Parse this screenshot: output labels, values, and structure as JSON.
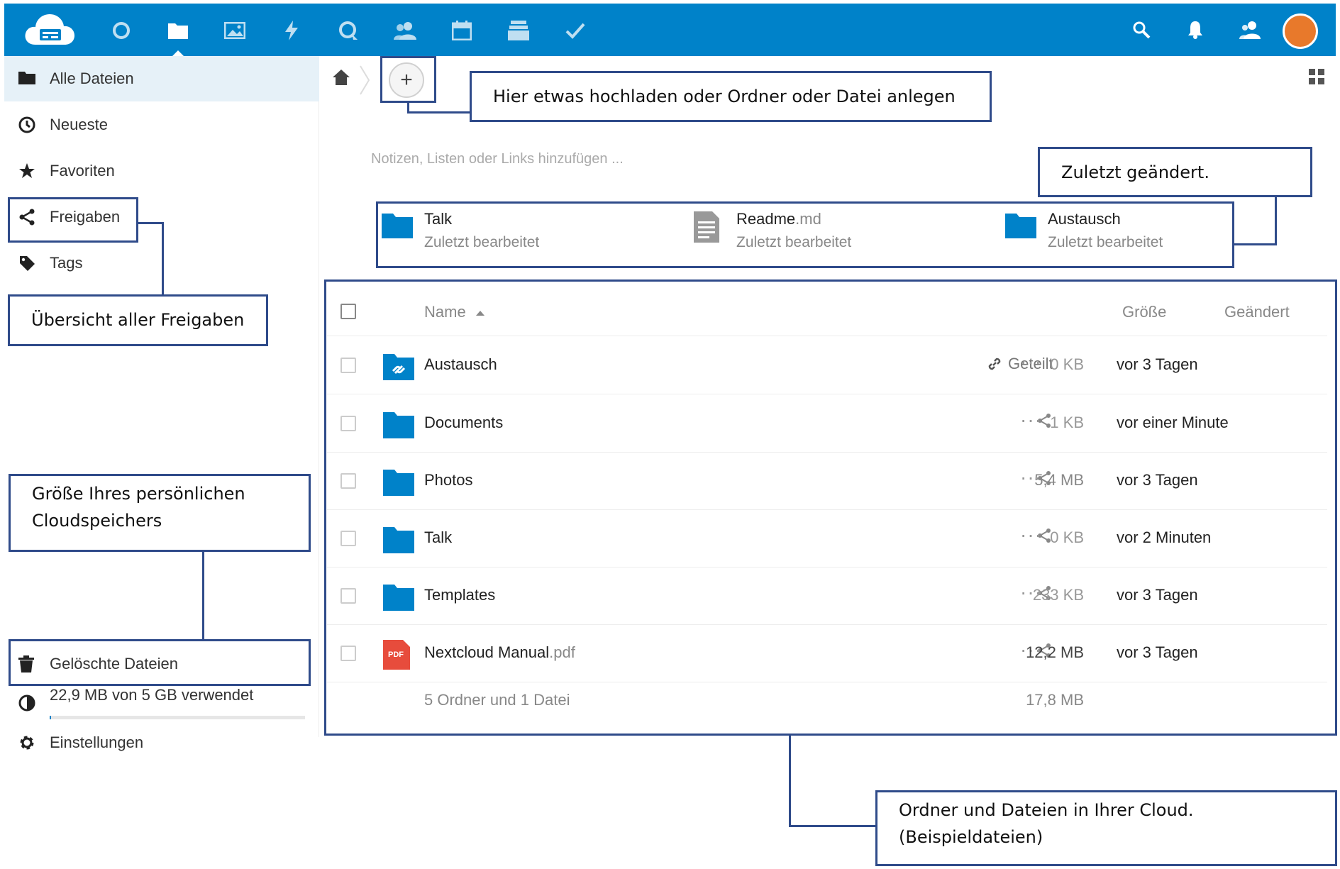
{
  "header": {
    "apps": [
      {
        "name": "dashboard-icon"
      },
      {
        "name": "files-icon",
        "active": true
      },
      {
        "name": "photos-icon"
      },
      {
        "name": "activity-icon"
      },
      {
        "name": "talk-icon"
      },
      {
        "name": "contacts-icon"
      },
      {
        "name": "calendar-icon"
      },
      {
        "name": "deck-icon"
      },
      {
        "name": "tasks-icon"
      }
    ],
    "right_icons": [
      "search-icon",
      "notifications-icon",
      "contacts-menu-icon"
    ],
    "avatar_color": "#e8792b",
    "bar_color": "#0082c9"
  },
  "sidebar": {
    "items": [
      {
        "label": "Alle Dateien",
        "icon": "folder-icon"
      },
      {
        "label": "Neueste",
        "icon": "clock-icon"
      },
      {
        "label": "Favoriten",
        "icon": "star-icon"
      },
      {
        "label": "Freigaben",
        "icon": "share-icon"
      },
      {
        "label": "Tags",
        "icon": "tag-icon"
      }
    ],
    "deleted": {
      "label": "Gelöschte Dateien",
      "icon": "trash-icon"
    },
    "quota": {
      "label": "22,9 MB von 5 GB verwendet",
      "fraction": 0.0045,
      "icon": "pie-chart-icon"
    },
    "settings": {
      "label": "Einstellungen",
      "icon": "gear-icon"
    }
  },
  "main": {
    "add_button_label": "+",
    "rich_workspace_placeholder": "Notizen, Listen oder Links hinzufügen ...",
    "recent": [
      {
        "name": "Talk",
        "ext": "",
        "subtitle": "Zuletzt bearbeitet",
        "icon": "folder-icon"
      },
      {
        "name": "Readme",
        "ext": ".md",
        "subtitle": "Zuletzt bearbeitet",
        "icon": "text-file-icon"
      },
      {
        "name": "Austausch",
        "ext": "",
        "subtitle": "Zuletzt bearbeitet",
        "icon": "folder-icon"
      }
    ],
    "table": {
      "headers": {
        "name": "Name",
        "size": "Größe",
        "modified": "Geändert"
      },
      "rows": [
        {
          "name": "Austausch",
          "ext": "",
          "icon": "shared-folder-icon",
          "share_label": "Geteilt",
          "size": "0 KB",
          "modified": "vor 3 Tagen",
          "size_color": "#999999"
        },
        {
          "name": "Documents",
          "ext": "",
          "icon": "folder-icon",
          "share_label": "",
          "size": "1 KB",
          "modified": "vor einer Minute",
          "size_color": "#999999"
        },
        {
          "name": "Photos",
          "ext": "",
          "icon": "folder-icon",
          "share_label": "",
          "size": "5,4 MB",
          "modified": "vor 3 Tagen",
          "size_color": "#888888"
        },
        {
          "name": "Talk",
          "ext": "",
          "icon": "folder-icon",
          "share_label": "",
          "size": "0 KB",
          "modified": "vor 2 Minuten",
          "size_color": "#999999"
        },
        {
          "name": "Templates",
          "ext": "",
          "icon": "folder-icon",
          "share_label": "",
          "size": "233 KB",
          "modified": "vor 3 Tagen",
          "size_color": "#999999"
        },
        {
          "name": "Nextcloud Manual",
          "ext": ".pdf",
          "icon": "pdf-icon",
          "share_label": "",
          "size": "12,2 MB",
          "modified": "vor 3 Tagen",
          "size_color": "#444444"
        }
      ],
      "summary": {
        "text": "5 Ordner und 1 Datei",
        "size": "17,8 MB"
      }
    },
    "pdf_badge": "PDF"
  },
  "annotations": {
    "upload": "Hier etwas hochladen oder Ordner oder Datei anlegen",
    "recent": "Zuletzt geändert.",
    "shares": "Übersicht aller Freigaben",
    "quota_line1": "Größe Ihres persönlichen",
    "quota_line2": "Cloudspeichers",
    "files_line1": "Ordner und Dateien in Ihrer Cloud.",
    "files_line2": "(Beispieldateien)"
  },
  "colors": {
    "accent": "#0082c9",
    "annotation": "#2f4b8a",
    "folder": "#0082c9",
    "pdf": "#e74c3c"
  }
}
